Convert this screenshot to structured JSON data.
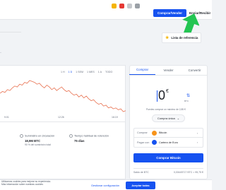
{
  "header": {
    "buy_sell_label": "Comprar/Vender",
    "send_receive_label": "Enviar/Recibir",
    "icons": [
      "extension-icon",
      "notification-icon",
      "profile-icon",
      "account-icon"
    ]
  },
  "watchlist": {
    "label": "Lista de referencia"
  },
  "chart": {
    "ranges": [
      "1 H",
      "1 D",
      "1 SEM",
      "1 MES",
      "1 A",
      "TODO"
    ],
    "active_range": "1 D",
    "x_ticks": [
      "9:01",
      "12:26",
      "16:19"
    ],
    "accent_color": "#e8704f"
  },
  "chart_data": {
    "type": "line",
    "title": "",
    "series": [
      {
        "values": [
          60,
          62,
          61,
          64,
          63,
          66,
          68,
          67,
          70,
          69,
          72,
          71,
          74,
          73,
          72,
          70,
          71,
          68,
          66,
          69,
          67,
          64,
          66,
          63,
          65,
          67,
          64,
          62,
          63,
          60,
          58,
          59,
          56,
          58,
          55,
          57,
          54,
          52,
          53,
          50,
          48,
          49,
          46,
          47,
          44,
          45,
          43,
          44,
          42,
          43,
          40,
          41
        ]
      }
    ],
    "grid": false
  },
  "stats": {
    "supply_label": "Suministro en circulación",
    "supply_value": "18,9M BTC",
    "supply_sub": "90 % del suministro total",
    "hold_label": "Tiempo habitual de retención",
    "hold_value": "75 días"
  },
  "trade": {
    "tabs": [
      "Comprar",
      "Vender",
      "Convertir"
    ],
    "amount": "0",
    "currency_symbol": "€",
    "swap_label": "BTC",
    "limit_text": "Puedes comprar un máximo de 2,85 €",
    "frequency": "Compra única",
    "buy_label": "Comprar",
    "buy_asset": "Bitcoin",
    "pay_label": "Pagar con",
    "pay_method": "Cartera de Euro",
    "buy_button": "Comprar Bitcoin",
    "balance_label": "Saldo de BTC",
    "balance_value": "0,00445717 BTC = 95,75 €",
    "btc_color": "#f7931a",
    "eur_color": "#1652f0"
  },
  "cookie": {
    "text": "Utilizamos cookies para mejorar su experiencia. Más información sobre nuestras cookies",
    "manage_label": "Gestionar configuración",
    "accept_label": "Aceptar todas"
  }
}
